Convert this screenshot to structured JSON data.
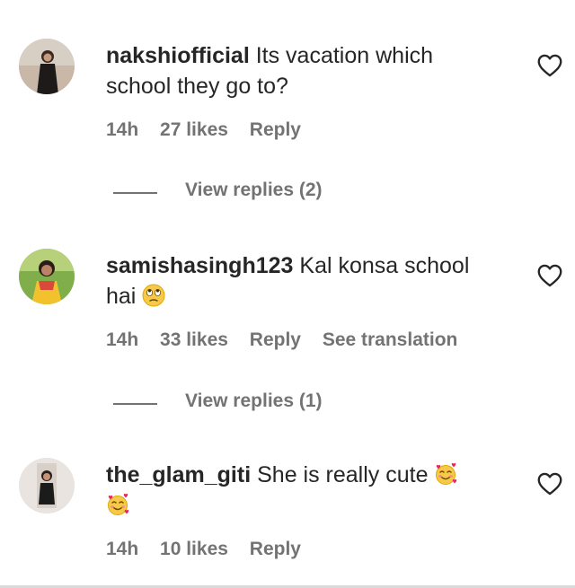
{
  "comments": [
    {
      "username": "nakshiofficial",
      "text": "Its vacation which school they go to?",
      "time": "14h",
      "likes": "27 likes",
      "reply_label": "Reply",
      "view_replies": "View replies (2)",
      "avatar_icon": "avatar-photo"
    },
    {
      "username": "samishasingh123",
      "text": "Kal konsa school hai",
      "emoji": "face-with-rolling-eyes",
      "time": "14h",
      "likes": "33 likes",
      "reply_label": "Reply",
      "translation_label": "See translation",
      "view_replies": "View replies (1)",
      "avatar_icon": "avatar-photo"
    },
    {
      "username": "the_glam_giti",
      "text": "She is really cute",
      "emoji": "smiling-face-with-hearts",
      "time": "14h",
      "likes": "10 likes",
      "reply_label": "Reply",
      "avatar_icon": "avatar-photo"
    }
  ],
  "colors": {
    "text": "#262626",
    "secondary": "#737373",
    "background": "#ffffff"
  },
  "icons": {
    "like": "heart-outline-icon"
  }
}
